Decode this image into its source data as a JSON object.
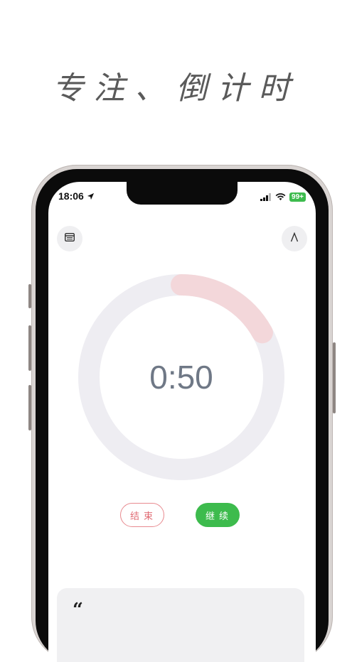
{
  "headline": "专注、倒计时",
  "status": {
    "time": "18:06",
    "battery": "99+"
  },
  "timer": {
    "display": "0:50",
    "progress": 0.17
  },
  "buttons": {
    "end_label": "结束",
    "continue_label": "继续"
  },
  "quote": {
    "mark": "“"
  },
  "colors": {
    "accent_green": "#3dbb4d",
    "accent_red": "#e06a72",
    "ring_track": "#eeedf2",
    "ring_progress": "#f3d7da"
  },
  "icons": {
    "left_button": "calendar-icon",
    "right_button": "theme-a-icon"
  }
}
